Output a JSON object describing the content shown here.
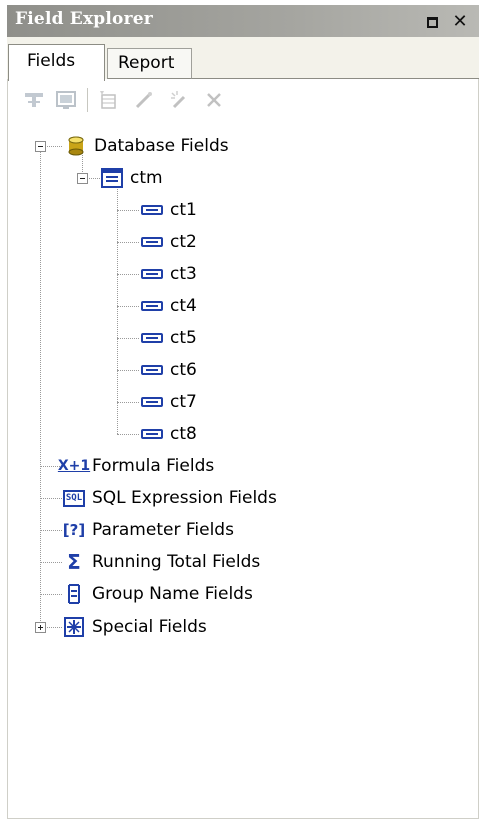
{
  "window": {
    "title": "Field Explorer"
  },
  "tabs": [
    {
      "label": "Fields",
      "active": true
    },
    {
      "label": "Report",
      "active": false
    }
  ],
  "toolbar": {
    "icons": [
      "insert-to-report-icon",
      "browse-data-icon",
      "new-icon",
      "edit-icon",
      "rename-icon",
      "delete-icon"
    ]
  },
  "tree": {
    "database_fields": {
      "label": "Database Fields",
      "table": {
        "label": "ctm",
        "fields": [
          "ct1",
          "ct2",
          "ct3",
          "ct4",
          "ct5",
          "ct6",
          "ct7",
          "ct8"
        ]
      }
    },
    "formula_fields": {
      "label": "Formula Fields",
      "icon_text": "X+1"
    },
    "sql_expression_fields": {
      "label": "SQL Expression Fields",
      "icon_text": "SQL"
    },
    "parameter_fields": {
      "label": "Parameter Fields",
      "icon_text": "[?]"
    },
    "running_total_fields": {
      "label": "Running Total Fields",
      "icon_text": "Σ"
    },
    "group_name_fields": {
      "label": "Group Name Fields"
    },
    "special_fields": {
      "label": "Special Fields"
    }
  },
  "colors": {
    "titlebar": "#a0a09b",
    "field_icon": "#1f3fa8",
    "tree_lines": "#9a9a9a"
  }
}
